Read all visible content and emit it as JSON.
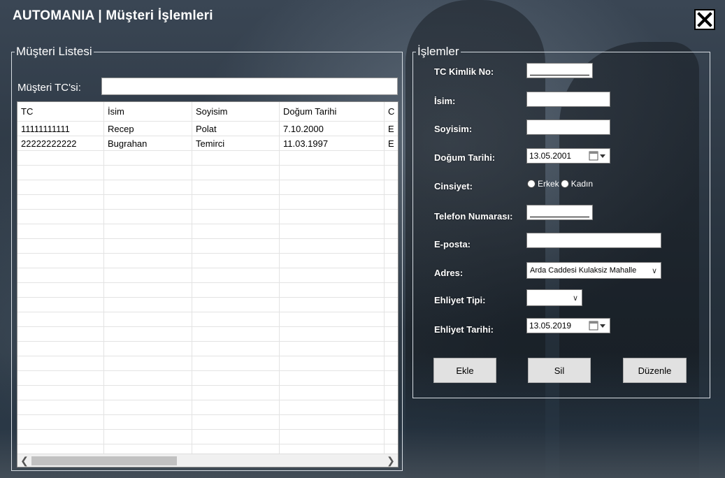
{
  "window": {
    "title": "AUTOMANIA | Müşteri İşlemleri"
  },
  "left_panel": {
    "legend": "Müşteri Listesi",
    "search_label": "Müşteri  TC'si:",
    "search_value": ""
  },
  "grid": {
    "columns": [
      "TC",
      "İsim",
      "Soyisim",
      "Doğum Tarihi",
      "C"
    ],
    "rows": [
      [
        "11111111111",
        "Recep",
        "Polat",
        "7.10.2000",
        "E"
      ],
      [
        "22222222222",
        "Bugrahan",
        "Temirci",
        "11.03.1997",
        "E"
      ]
    ]
  },
  "right_panel": {
    "legend": "İşlemler",
    "labels": {
      "tc": "TC Kimlik No:",
      "isim": "İsim:",
      "soyisim": "Soyisim:",
      "dogum": "Doğum Tarihi:",
      "cinsiyet": "Cinsiyet:",
      "telefon": "Telefon Numarası:",
      "eposta": "E-posta:",
      "adres": "Adres:",
      "ehliyet_tipi": "Ehliyet Tipi:",
      "ehliyet_tarihi": "Ehliyet Tarihi:"
    },
    "values": {
      "dogum_tarihi": "13.05.2001",
      "adres": "Arda Caddesi Kulaksiz Mahalle",
      "ehliyet_tipi": "",
      "ehliyet_tarihi": "13.05.2019"
    },
    "radio": {
      "erkek": "Erkek",
      "kadin": "Kadın"
    },
    "buttons": {
      "ekle": "Ekle",
      "sil": "Sil",
      "duzenle": "Düzenle"
    }
  },
  "icons": [
    "close-icon",
    "calendar-icon",
    "dropdown-arrow-icon",
    "chevron-down-icon",
    "scroll-left-icon",
    "scroll-right-icon"
  ]
}
